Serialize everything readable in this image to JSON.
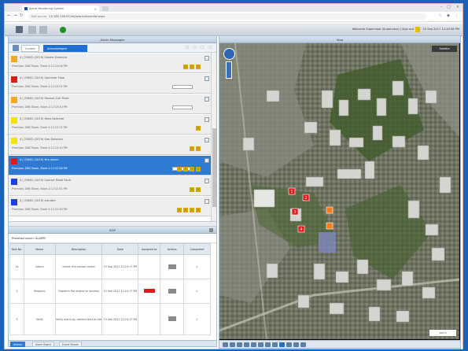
{
  "browser": {
    "tab_title": "Alarm Monitoring System",
    "url": "10.182.136.67/vfd/alarm/alarmlist.aspx",
    "url_prefix": "Not secure"
  },
  "header": {
    "user_text": "Welcome Supervisor (Supervisor) | Sign out",
    "datetime": "23 Sep 2017 12:24:36 PM"
  },
  "alarm_panel": {
    "title": "Alarm Messages",
    "tabs": [
      "Current",
      "Acknowledged"
    ],
    "alarms": [
      {
        "color": "#f5a623",
        "line1": "4 | 23602 (2019) Smoke Detector",
        "line2": "Premises: DBS Tower, Block A 12:24:08 PM",
        "actions": [
          "!",
          "!",
          "!"
        ],
        "ack_field": false,
        "selected": false
      },
      {
        "color": "#e31a1a",
        "line1": "4 | 23602 (2019) Sprinkler Flow",
        "line2": "Premises: DBS Tower, Block A 12:23:51 PM",
        "actions": [],
        "ack_field": true,
        "selected": false
      },
      {
        "color": "#f5a623",
        "line1": "4 | 23602 (2019) Manual Call Point",
        "line2": "Premises: DBS Tower, Block A 12:23:40 PM",
        "actions": [],
        "ack_field": true,
        "selected": false
      },
      {
        "color": "#f2e600",
        "line1": "4 | 23602 (2019) Heat Detector",
        "line2": "Premises: DBS Tower, Block A 12:23:22 PM",
        "actions": [
          "!"
        ],
        "ack_field": false,
        "selected": false
      },
      {
        "color": "#f2e600",
        "line1": "4 | 23602 (2019) Gas Detector",
        "line2": "Premises: DBS Tower, Block A 12:23:10 PM",
        "actions": [
          "!",
          "!"
        ],
        "ack_field": false,
        "selected": false
      },
      {
        "color": "#e31a1a",
        "line1": "4 | 23602 (2019) Fire Alarm",
        "line2": "Premises: DBS Tower, Block A 12:22:58 PM",
        "actions": [
          "!",
          "!",
          "!",
          "!"
        ],
        "ack_field": true,
        "selected": true
      },
      {
        "color": "#1a3ee3",
        "line1": "4 | 23602 (2019) Control Panel Fault",
        "line2": "Premises: DBS Tower, Block A 12:22:41 PM",
        "actions": [
          "!",
          "!"
        ],
        "ack_field": false,
        "selected": false
      },
      {
        "color": "#1a3ee3",
        "line1": "4 | 23602 (2019) Intruder",
        "line2": "Premises: DBS Tower, Block A 12:22:30 PM",
        "actions": [
          "!",
          "!",
          "!",
          "!"
        ],
        "ack_field": false,
        "selected": false
      }
    ]
  },
  "workflow_panel": {
    "title": "SOP",
    "info": "Premises alarm: ALARM",
    "columns": [
      "Task No.",
      "Name",
      "Description",
      "Date",
      "Assigned to",
      "Actions",
      "Completed"
    ],
    "rows": [
      {
        "no": "1a",
        "name": "Inform",
        "desc": "Inform fire control centre",
        "date": "23 Sep 2017 12:24:17 PM",
        "assigned": "",
        "done": "✔"
      },
      {
        "no": "2",
        "name": "Respond",
        "desc": "Dispatch fire engine to location",
        "date": "23 Sep 2017 12:24:17 PM",
        "assigned": "red",
        "done": "✔"
      },
      {
        "no": "3",
        "name": "Verify",
        "desc": "Verify alarm by camera feed at site",
        "date": "23 Sep 2017 12:24:17 PM",
        "assigned": "",
        "done": "✔"
      }
    ]
  },
  "bottom_tabs": [
    "Alarms",
    "Alarm Board",
    "Event Viewer"
  ],
  "map_panel": {
    "title": "Map",
    "layer_label": "Satellite",
    "scale_label": "100 m",
    "markers": [
      {
        "color": "#e31a1a",
        "label": "1"
      },
      {
        "color": "#e31a1a",
        "label": "2"
      },
      {
        "color": "#e31a1a",
        "label": "3"
      },
      {
        "color": "#f47b20",
        "label": ""
      },
      {
        "color": "#f47b20",
        "label": ""
      },
      {
        "color": "#e31a1a",
        "label": "4"
      }
    ]
  }
}
